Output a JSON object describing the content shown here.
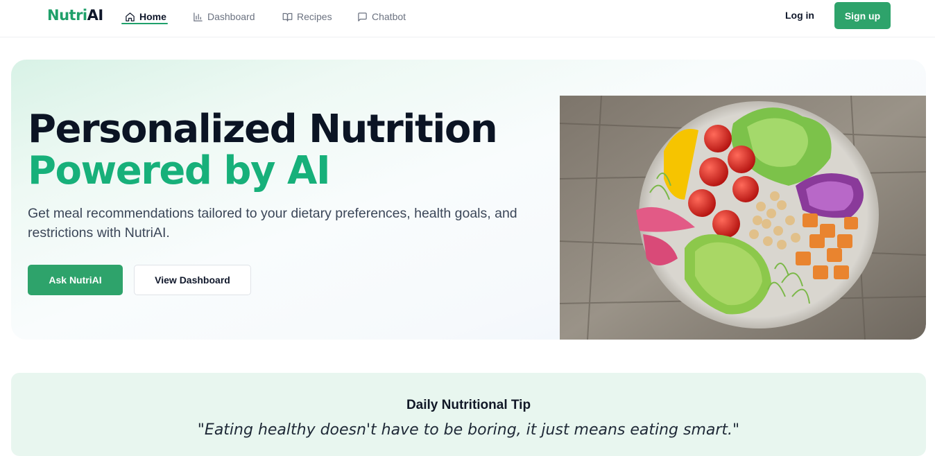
{
  "brand": {
    "part1": "Nutri",
    "part2": "AI"
  },
  "nav": {
    "items": [
      {
        "label": "Home",
        "icon": "home-icon",
        "active": true
      },
      {
        "label": "Dashboard",
        "icon": "bar-chart-icon",
        "active": false
      },
      {
        "label": "Recipes",
        "icon": "book-open-icon",
        "active": false
      },
      {
        "label": "Chatbot",
        "icon": "message-square-icon",
        "active": false
      }
    ],
    "login_label": "Log in",
    "signup_label": "Sign up"
  },
  "hero": {
    "title_line1": "Personalized Nutrition",
    "title_line2": "Powered by AI",
    "subtitle": "Get meal recommendations tailored to your dietary preferences, health goals, and restrictions with NutriAI.",
    "primary_button": "Ask NutriAI",
    "secondary_button": "View Dashboard",
    "image": "healthy-salad-bowl-photo"
  },
  "tip": {
    "heading": "Daily Nutritional Tip",
    "quote": "\"Eating healthy doesn't have to be boring, it just means eating smart.\""
  },
  "colors": {
    "brand_green": "#2ea36b",
    "accent_green": "#17b07a",
    "dark_text": "#0b1424",
    "tip_background": "#e8f6ef"
  }
}
